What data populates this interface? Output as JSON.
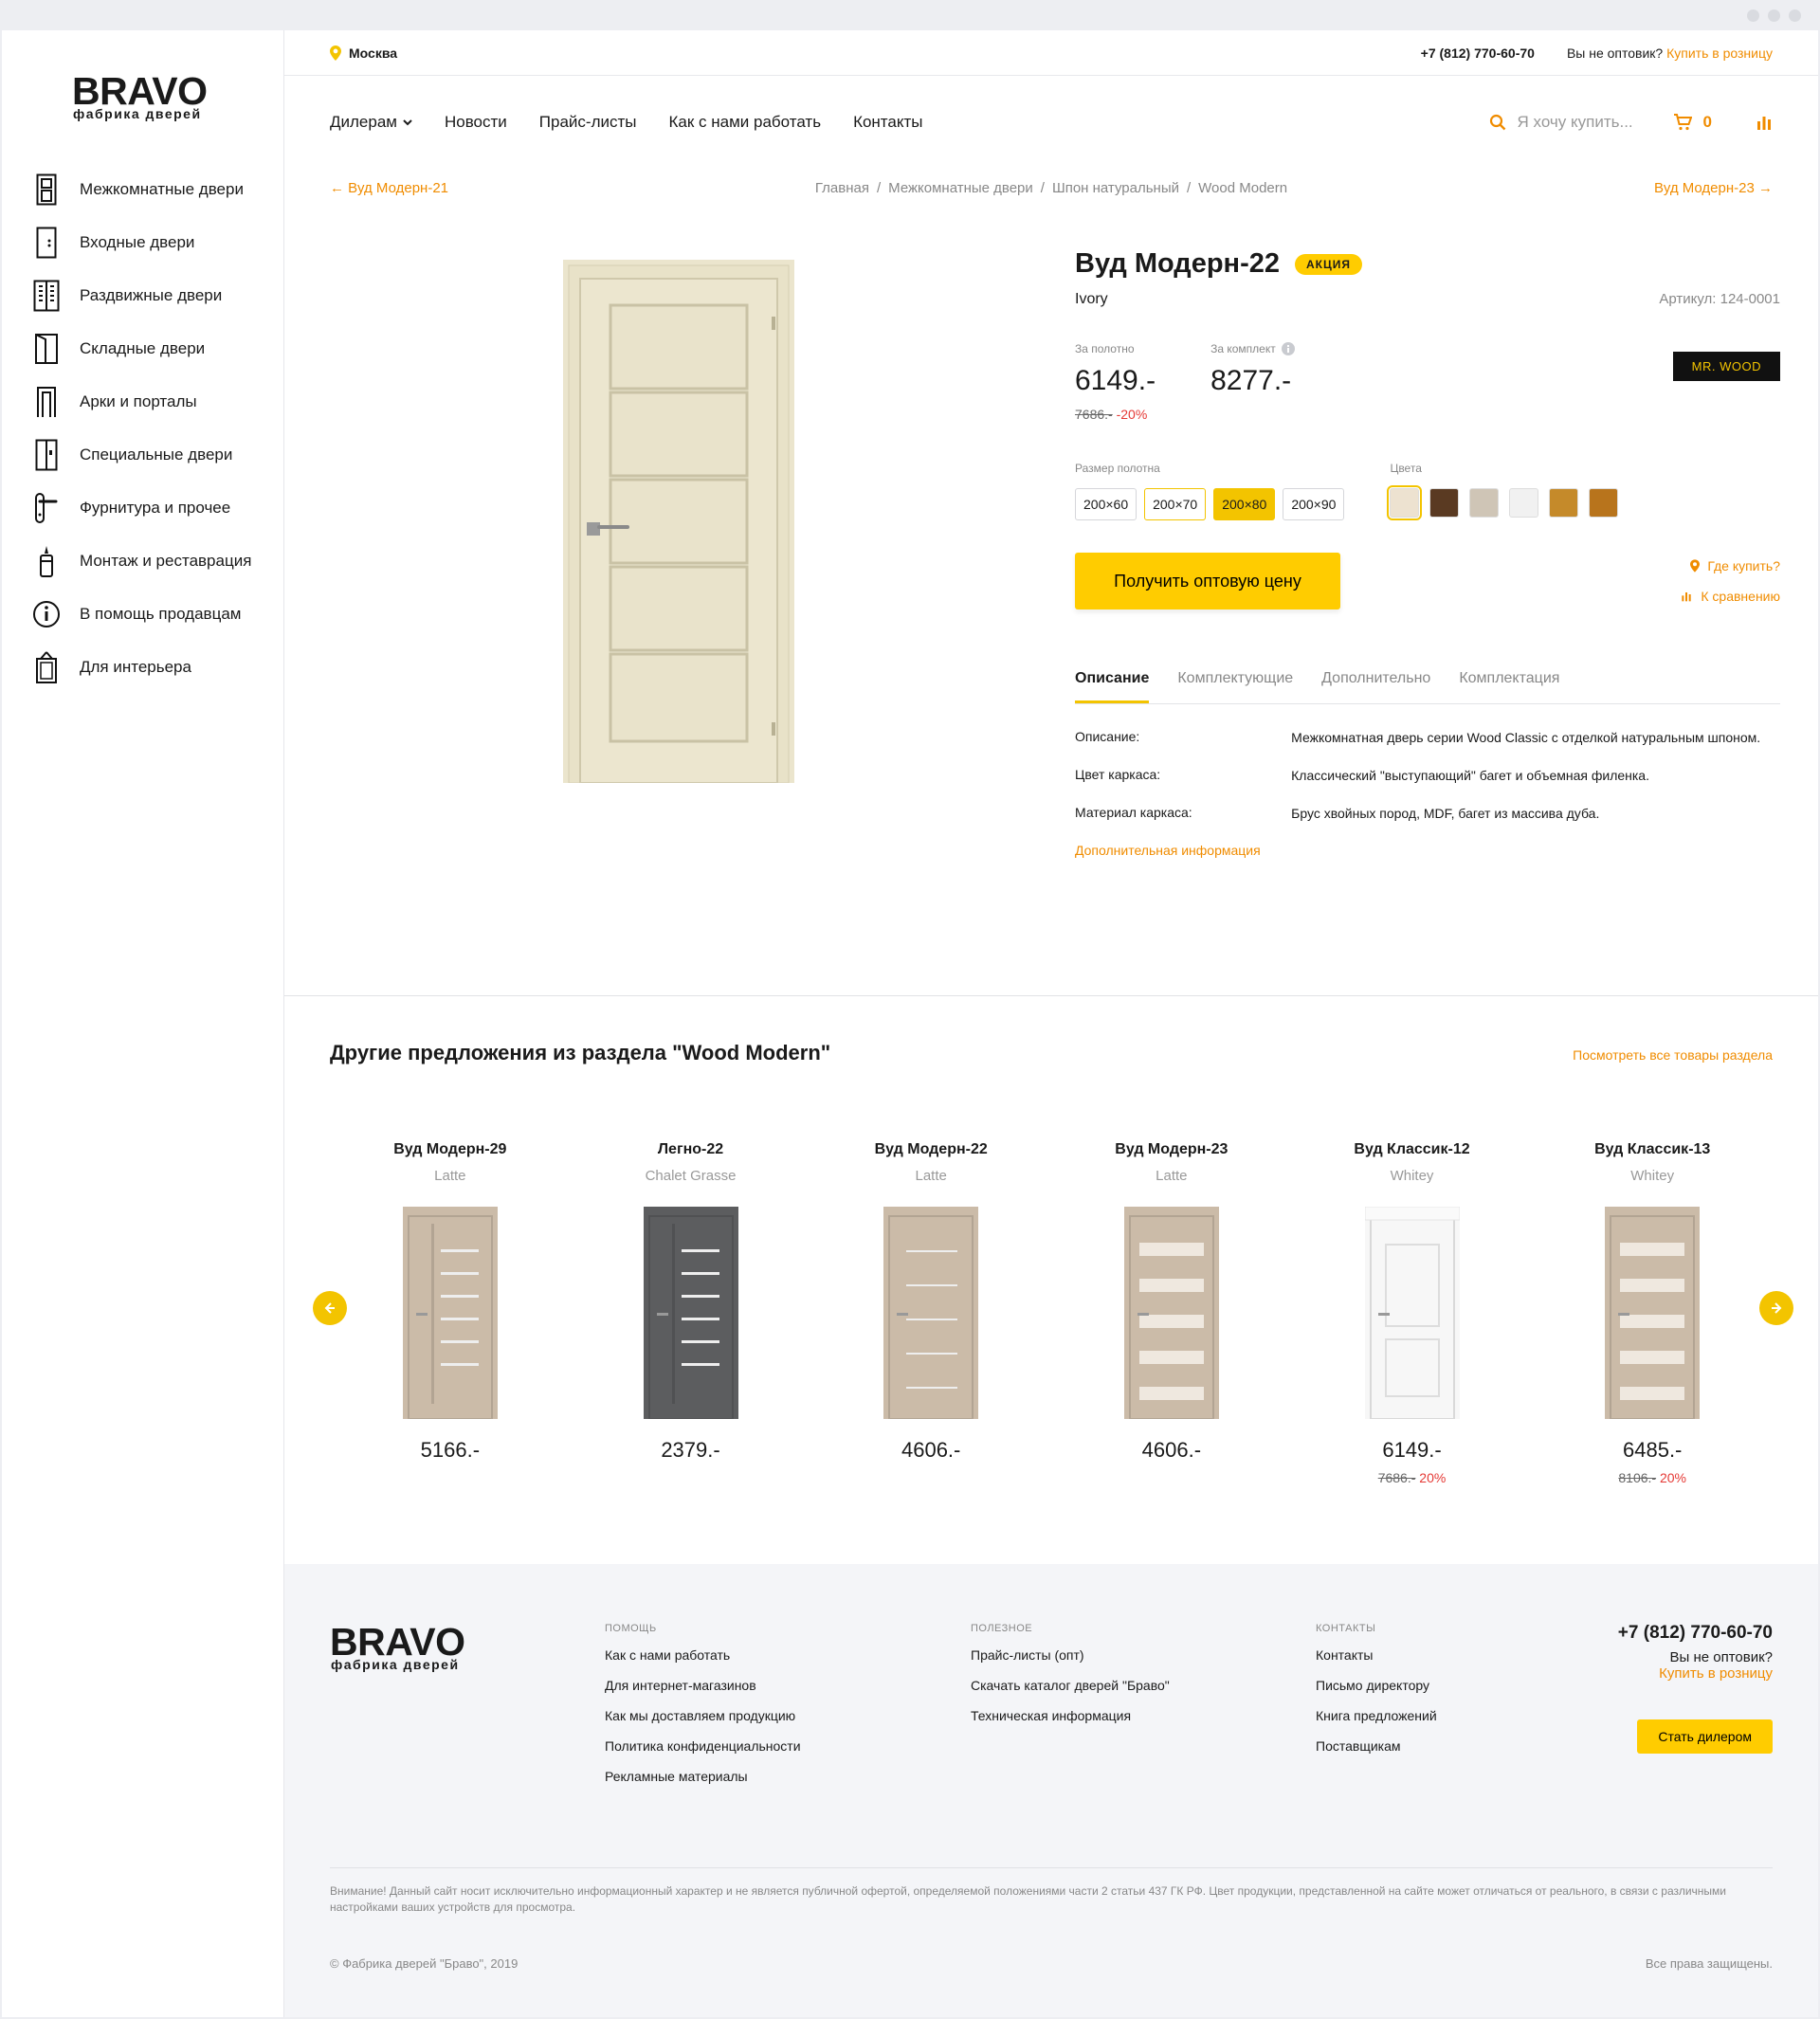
{
  "sidebar": {
    "brand_big": "BRAVO",
    "brand_small": "фабрика дверей",
    "items": [
      {
        "label": "Межкомнатные двери",
        "icon": "interior-door-icon"
      },
      {
        "label": "Входные двери",
        "icon": "entrance-door-icon"
      },
      {
        "label": "Раздвижные двери",
        "icon": "sliding-door-icon"
      },
      {
        "label": "Складные двери",
        "icon": "folding-door-icon"
      },
      {
        "label": "Арки и порталы",
        "icon": "arch-icon"
      },
      {
        "label": "Специальные двери",
        "icon": "special-door-icon"
      },
      {
        "label": "Фурнитура и прочее",
        "icon": "door-handle-icon"
      },
      {
        "label": "Монтаж и реставрация",
        "icon": "sealant-icon"
      },
      {
        "label": "В помощь продавцам",
        "icon": "info-icon"
      },
      {
        "label": "Для интерьера",
        "icon": "frame-icon"
      }
    ]
  },
  "topbar": {
    "city": "Москва",
    "phone": "+7 (812) 770-60-70",
    "question": "Вы не оптовик?",
    "retail_link": "Купить в розницу"
  },
  "nav": {
    "items": [
      "Дилерам",
      "Новости",
      "Прайс-листы",
      "Как с нами работать",
      "Контакты"
    ],
    "search_placeholder": "Я хочу купить...",
    "cart_count": "0"
  },
  "breadcrumbs": {
    "prev": "← Вуд Модерн-21",
    "next": "Вуд Модерн-23 →",
    "items": [
      "Главная",
      "Межкомнатные двери",
      "Шпон натуральный",
      "Wood Modern"
    ]
  },
  "product": {
    "title": "Вуд Модерн-22",
    "badge": "АКЦИЯ",
    "color_name": "Ivory",
    "sku": "Артикул: 124-0001",
    "price_leaf_label": "За полотно",
    "price_leaf": "6149.-",
    "price_old": "7686.-",
    "discount": "-20%",
    "price_set_label": "За комплект",
    "price_set": "8277.-",
    "brand": "MR. WOOD",
    "size_label": "Размер полотна",
    "sizes": [
      "200×60",
      "200×70",
      "200×80",
      "200×90"
    ],
    "selected_size": "200×80",
    "colors_label": "Цвета",
    "colors": [
      "#ede2d0",
      "#5a3a22",
      "#cfc5b6",
      "#f1f1f1",
      "#c58a2a",
      "#b8741c"
    ],
    "cta": "Получить оптовую цену",
    "where_buy": "Где купить?",
    "compare": "К сравнению",
    "tabs": [
      "Описание",
      "Комплектующие",
      "Дополнительно",
      "Комплектация"
    ],
    "desc": [
      {
        "k": "Описание:",
        "v": "Межкомнатная дверь серии Wood Classic с отделкой натуральным шпоном."
      },
      {
        "k": "Цвет каркаса:",
        "v": "Классический \"выступающий\" багет и объемная филенка."
      },
      {
        "k": "Материал каркаса:",
        "v": "Брус хвойных пород, MDF, багет из массива дуба."
      }
    ],
    "more": "Дополнительная информация",
    "door_color": "#ece6cf"
  },
  "related": {
    "title": "Другие предложения из раздела \"Wood Modern\"",
    "view_all": "Посмотреть все товары раздела",
    "items": [
      {
        "name": "Вуд Модерн-29",
        "color": "Latte",
        "price": "5166.-",
        "old": "",
        "disc": "",
        "fill": "#cbbba8",
        "style": "bars"
      },
      {
        "name": "Легно-22",
        "color": "Chalet Grasse",
        "price": "2379.-",
        "old": "",
        "disc": "",
        "fill": "#5c5d5f",
        "style": "bars"
      },
      {
        "name": "Вуд Модерн-22",
        "color": "Latte",
        "price": "4606.-",
        "old": "",
        "disc": "",
        "fill": "#cbbba8",
        "style": "panels"
      },
      {
        "name": "Вуд Модерн-23",
        "color": "Latte",
        "price": "4606.-",
        "old": "",
        "disc": "",
        "fill": "#cbbba8",
        "style": "glass"
      },
      {
        "name": "Вуд Классик-12",
        "color": "Whitey",
        "price": "6149.-",
        "old": "7686.-",
        "disc": " 20%",
        "fill": "#f7f7f7",
        "style": "classic"
      },
      {
        "name": "Вуд Классик-13",
        "color": "Whitey",
        "price": "6485.-",
        "old": "8106.-",
        "disc": " 20%",
        "fill": "#cbbba8",
        "style": "glass"
      }
    ]
  },
  "footer": {
    "brand_big": "BRAVO",
    "brand_small": "фабрика дверей",
    "help_title": "ПОМОЩЬ",
    "help": [
      "Как с нами работать",
      "Для интернет-магазинов",
      "Как мы доставляем продукцию",
      "Политика конфиденциальности",
      "Рекламные материалы"
    ],
    "useful_title": "ПОЛЕЗНОЕ",
    "useful": [
      "Прайс-листы (опт)",
      "Скачать каталог дверей \"Браво\"",
      "Техническая информация"
    ],
    "contacts_title": "КОНТАКТЫ",
    "contacts": [
      "Контакты",
      "Письмо директору",
      "Книга предложений",
      "Поставщикам"
    ],
    "phone": "+7 (812) 770-60-70",
    "question": "Вы не оптовик?",
    "retail_link": "Купить в розницу",
    "dealer_btn": "Стать дилером",
    "disclaimer": "Внимание! Данный сайт носит исключительно информационный характер и не является публичной офертой, определяемой положениями части 2 статьи 437 ГК РФ. Цвет продукции, представленной на сайте может отличаться от реального, в связи с различными настройками ваших устройств для просмотра.",
    "copyright": "© Фабрика дверей \"Браво\", 2019",
    "rights": "Все права защищены."
  },
  "accent": "#f3c400",
  "link_color": "#f08c00"
}
